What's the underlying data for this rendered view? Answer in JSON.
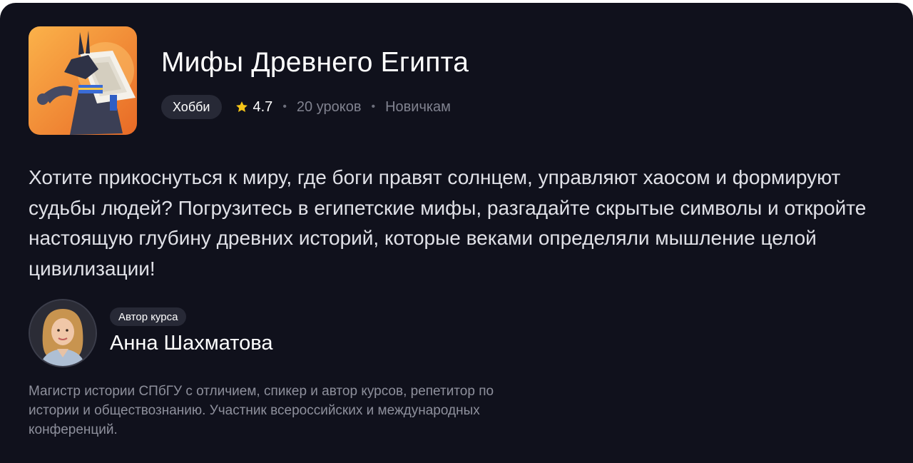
{
  "course": {
    "title": "Мифы Древнего Египта",
    "tag": "Хобби",
    "rating": "4.7",
    "lessons": "20 уроков",
    "level": "Новичкам",
    "cover_icon": "anubis-illustration",
    "description": "Хотите прикоснуться к миру, где боги правят солнцем, управляют хаосом и формируют судьбы людей? Погрузитесь в египетские мифы, разгадайте скрытые символы и откройте настоящую глубину древних историй, которые веками определяли мышление целой цивилизации!"
  },
  "author": {
    "tag": "Автор курса",
    "name": "Анна Шахматова",
    "bio": "Магистр истории СПбГУ с отличием, спикер и автор курсов, репетитор по истории и обществознанию. Участник всероссийских и международных конференций."
  },
  "colors": {
    "background": "#10111c",
    "pill": "#272936",
    "star": "#f5c518",
    "cover_gradient_start": "#f9a23a",
    "cover_gradient_end": "#e8702a"
  }
}
